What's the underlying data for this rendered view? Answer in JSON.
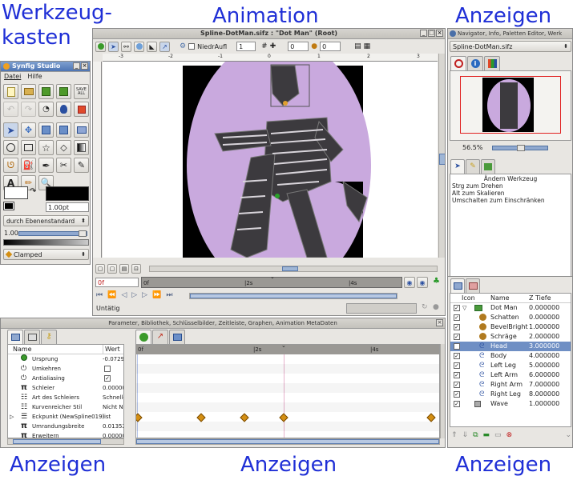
{
  "captions": {
    "toolbox": "Werkzeug-\nkasten",
    "toolbox_line1": "Werkzeug-",
    "toolbox_line2": "kasten",
    "animation": "Animation",
    "show_top_right": "Anzeigen",
    "show_bottom_left": "Anzeigen",
    "show_bottom_mid": "Anzeigen",
    "show_bottom_right": "Anzeigen"
  },
  "toolbox": {
    "title": "Synfig Studio",
    "menu": [
      "Datei",
      "Hilfe"
    ],
    "save_all_line1": "SAVE",
    "save_all_line2": "ALL",
    "width_value": "1.00pt",
    "blend_method": "durch Ebenenstandard",
    "amount_value": "1.00",
    "interpolation": "Clamped"
  },
  "canvas": {
    "title": "Spline-DotMan.sifz : \"Dot Man\" (Root)",
    "low_res_label": "NiedrAufl",
    "quality_value": "1",
    "onion_past": "0",
    "onion_future": "0",
    "ruler_top": [
      "-3",
      "-2",
      "-1",
      "0",
      "1",
      "2",
      "3"
    ],
    "current_time": "0f",
    "time_marks": [
      "0f",
      "|2s",
      "|4s"
    ],
    "status": "Untätig"
  },
  "navigator": {
    "title": "Navigator, Info, Paletten Editor, Werk",
    "file": "Spline-DotMan.sifz",
    "zoom": "56.5%",
    "tool_title": "Ändern Werkzeug",
    "tool_help": [
      "Strg zum Drehen",
      "Alt zum Skalieren",
      "Umschalten zum Einschränken"
    ]
  },
  "layers": {
    "columns": [
      "Icon",
      "Name",
      "Z Tiefe"
    ],
    "rows": [
      {
        "name": "Dot Man",
        "z": "0.000000",
        "kind": "folder",
        "selected": false,
        "indent": 0
      },
      {
        "name": "Schatten",
        "z": "0.000000",
        "kind": "circle",
        "selected": false,
        "indent": 1
      },
      {
        "name": "BevelBright",
        "z": "1.000000",
        "kind": "circle",
        "selected": false,
        "indent": 1
      },
      {
        "name": "Schräge",
        "z": "2.000000",
        "kind": "circle",
        "selected": false,
        "indent": 1
      },
      {
        "name": "Head",
        "z": "3.000000",
        "kind": "spline",
        "selected": true,
        "indent": 1
      },
      {
        "name": "Body",
        "z": "4.000000",
        "kind": "spline",
        "selected": false,
        "indent": 1
      },
      {
        "name": "Left Leg",
        "z": "5.000000",
        "kind": "spline",
        "selected": false,
        "indent": 1
      },
      {
        "name": "Left Arm",
        "z": "6.000000",
        "kind": "spline",
        "selected": false,
        "indent": 1
      },
      {
        "name": "Right Arm",
        "z": "7.000000",
        "kind": "spline",
        "selected": false,
        "indent": 1
      },
      {
        "name": "Right Leg",
        "z": "8.000000",
        "kind": "spline",
        "selected": false,
        "indent": 1
      },
      {
        "name": "Wave",
        "z": "1.000000",
        "kind": "square",
        "selected": false,
        "indent": 0
      }
    ]
  },
  "params": {
    "title": "Parameter, Bibliothek, Schlüsselbilder, Zeitleiste, Graphen, Animation MetaDaten",
    "col_name": "Name",
    "col_value": "Wert",
    "rows": [
      {
        "name": "Ursprung",
        "value": "-0.0729",
        "icon": "dot"
      },
      {
        "name": "Umkehren",
        "value": "",
        "icon": "power",
        "check": false
      },
      {
        "name": "Antialiasing",
        "value": "",
        "icon": "power",
        "check": true
      },
      {
        "name": "Schleier",
        "value": "0.00000",
        "icon": "pi"
      },
      {
        "name": "Art des Schleiers",
        "value": "Schnelle",
        "icon": "list"
      },
      {
        "name": "Kurvenreicher Stil",
        "value": "Nicht N",
        "icon": "list"
      },
      {
        "name": "Eckpunkt (NewSpline019)",
        "value": "list",
        "icon": "vertex"
      },
      {
        "name": "Umrandungsbreite",
        "value": "0.01352",
        "icon": "pi"
      },
      {
        "name": "Erweitern",
        "value": "0.0000C",
        "icon": "pi"
      }
    ],
    "timeline_marks": [
      "0f",
      "|2s",
      "|4s"
    ]
  }
}
